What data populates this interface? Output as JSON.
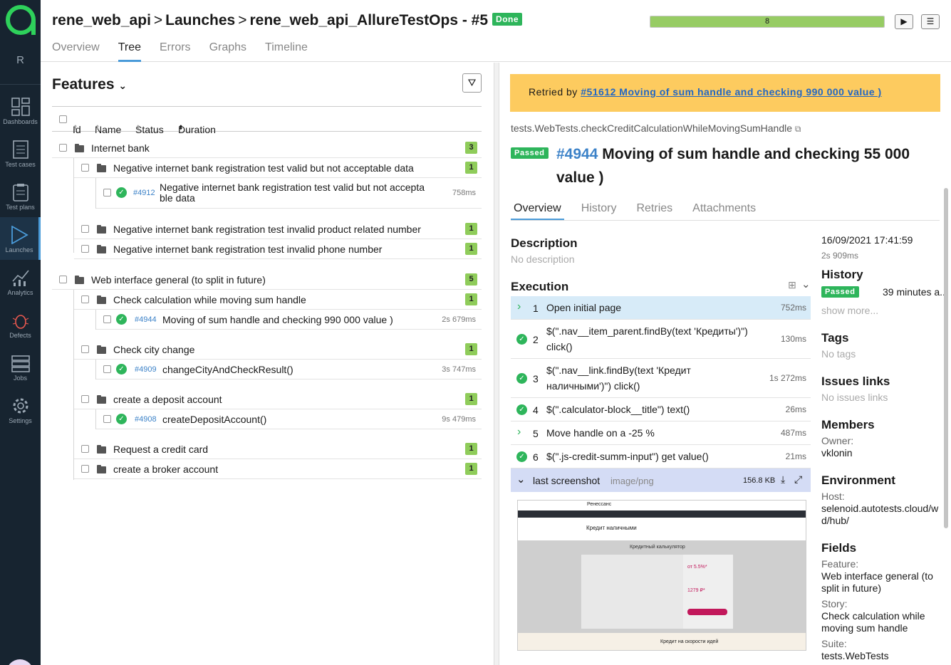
{
  "sidebar": {
    "user_letter": "R",
    "items": [
      {
        "label": "Dashboards",
        "icon": "dashboards-icon"
      },
      {
        "label": "Test cases",
        "icon": "test-cases-icon"
      },
      {
        "label": "Test plans",
        "icon": "test-plans-icon"
      },
      {
        "label": "Launches",
        "icon": "launches-icon"
      },
      {
        "label": "Analytics",
        "icon": "analytics-icon"
      },
      {
        "label": "Defects",
        "icon": "defects-icon"
      },
      {
        "label": "Jobs",
        "icon": "jobs-icon"
      },
      {
        "label": "Settings",
        "icon": "settings-icon"
      }
    ]
  },
  "header": {
    "crumb1": "rene_web_api",
    "crumb2": "Launches",
    "crumb3": "rene_web_api_AllureTestOps - #5",
    "separator": ">",
    "status": "Done",
    "progress_count": "8",
    "progress_fraction": 1.0,
    "tabs": [
      "Overview",
      "Tree",
      "Errors",
      "Graphs",
      "Timeline"
    ],
    "active_tab": "Tree"
  },
  "tree": {
    "title": "Features",
    "columns": [
      "Id",
      "Name",
      "Status",
      "Duration"
    ],
    "groups": [
      {
        "name": "Internet bank",
        "count": "3"
      },
      {
        "name": "Negative internet bank registration test valid but not acceptable data",
        "count": "1"
      },
      {
        "id": "#4912",
        "name1": "Negative internet bank registration test valid but not accepta",
        "name2": "ble data",
        "duration": "758ms"
      },
      {
        "name": "Negative internet bank registration test invalid product related number",
        "count": "1"
      },
      {
        "name": "Negative internet bank registration test invalid phone number",
        "count": "1"
      },
      {
        "name": "Web interface general (to split in future)",
        "count": "5"
      },
      {
        "name": "Check calculation while moving sum handle",
        "count": "1"
      },
      {
        "id": "#4944",
        "name": "Moving of sum handle and checking 990 000 value )",
        "duration": "2s 679ms"
      },
      {
        "name": "Check city change",
        "count": "1"
      },
      {
        "id": "#4909",
        "name": "changeCityAndCheckResult()",
        "duration": "3s 747ms"
      },
      {
        "name": "create a deposit account",
        "count": "1"
      },
      {
        "id": "#4908",
        "name": "createDepositAccount()",
        "duration": "9s 479ms"
      },
      {
        "name": "Request a credit card",
        "count": "1"
      },
      {
        "name": "create a broker account",
        "count": "1"
      }
    ]
  },
  "detail": {
    "retried_prefix": "Retried by",
    "retried_link": "#51612 Moving of sum handle and checking 990 000 value )",
    "full_name": "tests.WebTests.checkCreditCalculationWhileMovingSumHandle",
    "status": "Passed",
    "case_id": "#4944",
    "case_title": "Moving of sum handle and checking 55 000 value )",
    "tabs": [
      "Overview",
      "History",
      "Retries",
      "Attachments"
    ],
    "description_h": "Description",
    "description": "No description",
    "execution_h": "Execution",
    "steps": [
      {
        "num": "1",
        "text": "Open initial page",
        "duration": "752ms"
      },
      {
        "num": "2",
        "text": "$(\".nav__item_parent.findBy(text 'Кредиты')\") click()",
        "duration": "130ms"
      },
      {
        "num": "3",
        "text": "$(\".nav__link.findBy(text 'Кредит наличными')\") click()",
        "duration": "1s 272ms"
      },
      {
        "num": "4",
        "text": "$(\".calculator-block__title\") text()",
        "duration": "26ms"
      },
      {
        "num": "5",
        "text": "Move handle on a -25 %",
        "duration": "487ms"
      },
      {
        "num": "6",
        "text": "$(\".js-credit-summ-input\") get value()",
        "duration": "21ms"
      }
    ],
    "attachment": {
      "name": "last screenshot",
      "type": "image/png",
      "size": "156.8 KB"
    },
    "screenshot": {
      "brand": "Ренессанс",
      "heading": "Кредит наличными",
      "calc_title": "Кредитный калькулятор",
      "rate": "от 5.5%*",
      "payment": "1279 ₽*",
      "footer": "Кредит на скорости идей"
    }
  },
  "meta": {
    "date": "16/09/2021 17:41:59",
    "duration": "2s 909ms",
    "history_h": "History",
    "history_status": "Passed",
    "history_time": "39 minutes a...",
    "show_more": "show more...",
    "tags_h": "Tags",
    "tags": "No tags",
    "issues_h": "Issues links",
    "issues": "No issues links",
    "members_h": "Members",
    "owner_lbl": "Owner:",
    "owner": "vklonin",
    "env_h": "Environment",
    "host_lbl": "Host:",
    "host": "selenoid.autotests.cloud/wd/hub/",
    "fields_h": "Fields",
    "feature_lbl": "Feature:",
    "feature": "Web interface general (to split in future)",
    "story_lbl": "Story:",
    "story": "Check calculation while moving sum handle",
    "suite_lbl": "Suite:",
    "suite": "tests.WebTests"
  },
  "colors": {
    "passed": "#2eb55b",
    "accent": "#4a9bd9",
    "banner": "#fdcb5f",
    "sidebar": "#172430"
  }
}
